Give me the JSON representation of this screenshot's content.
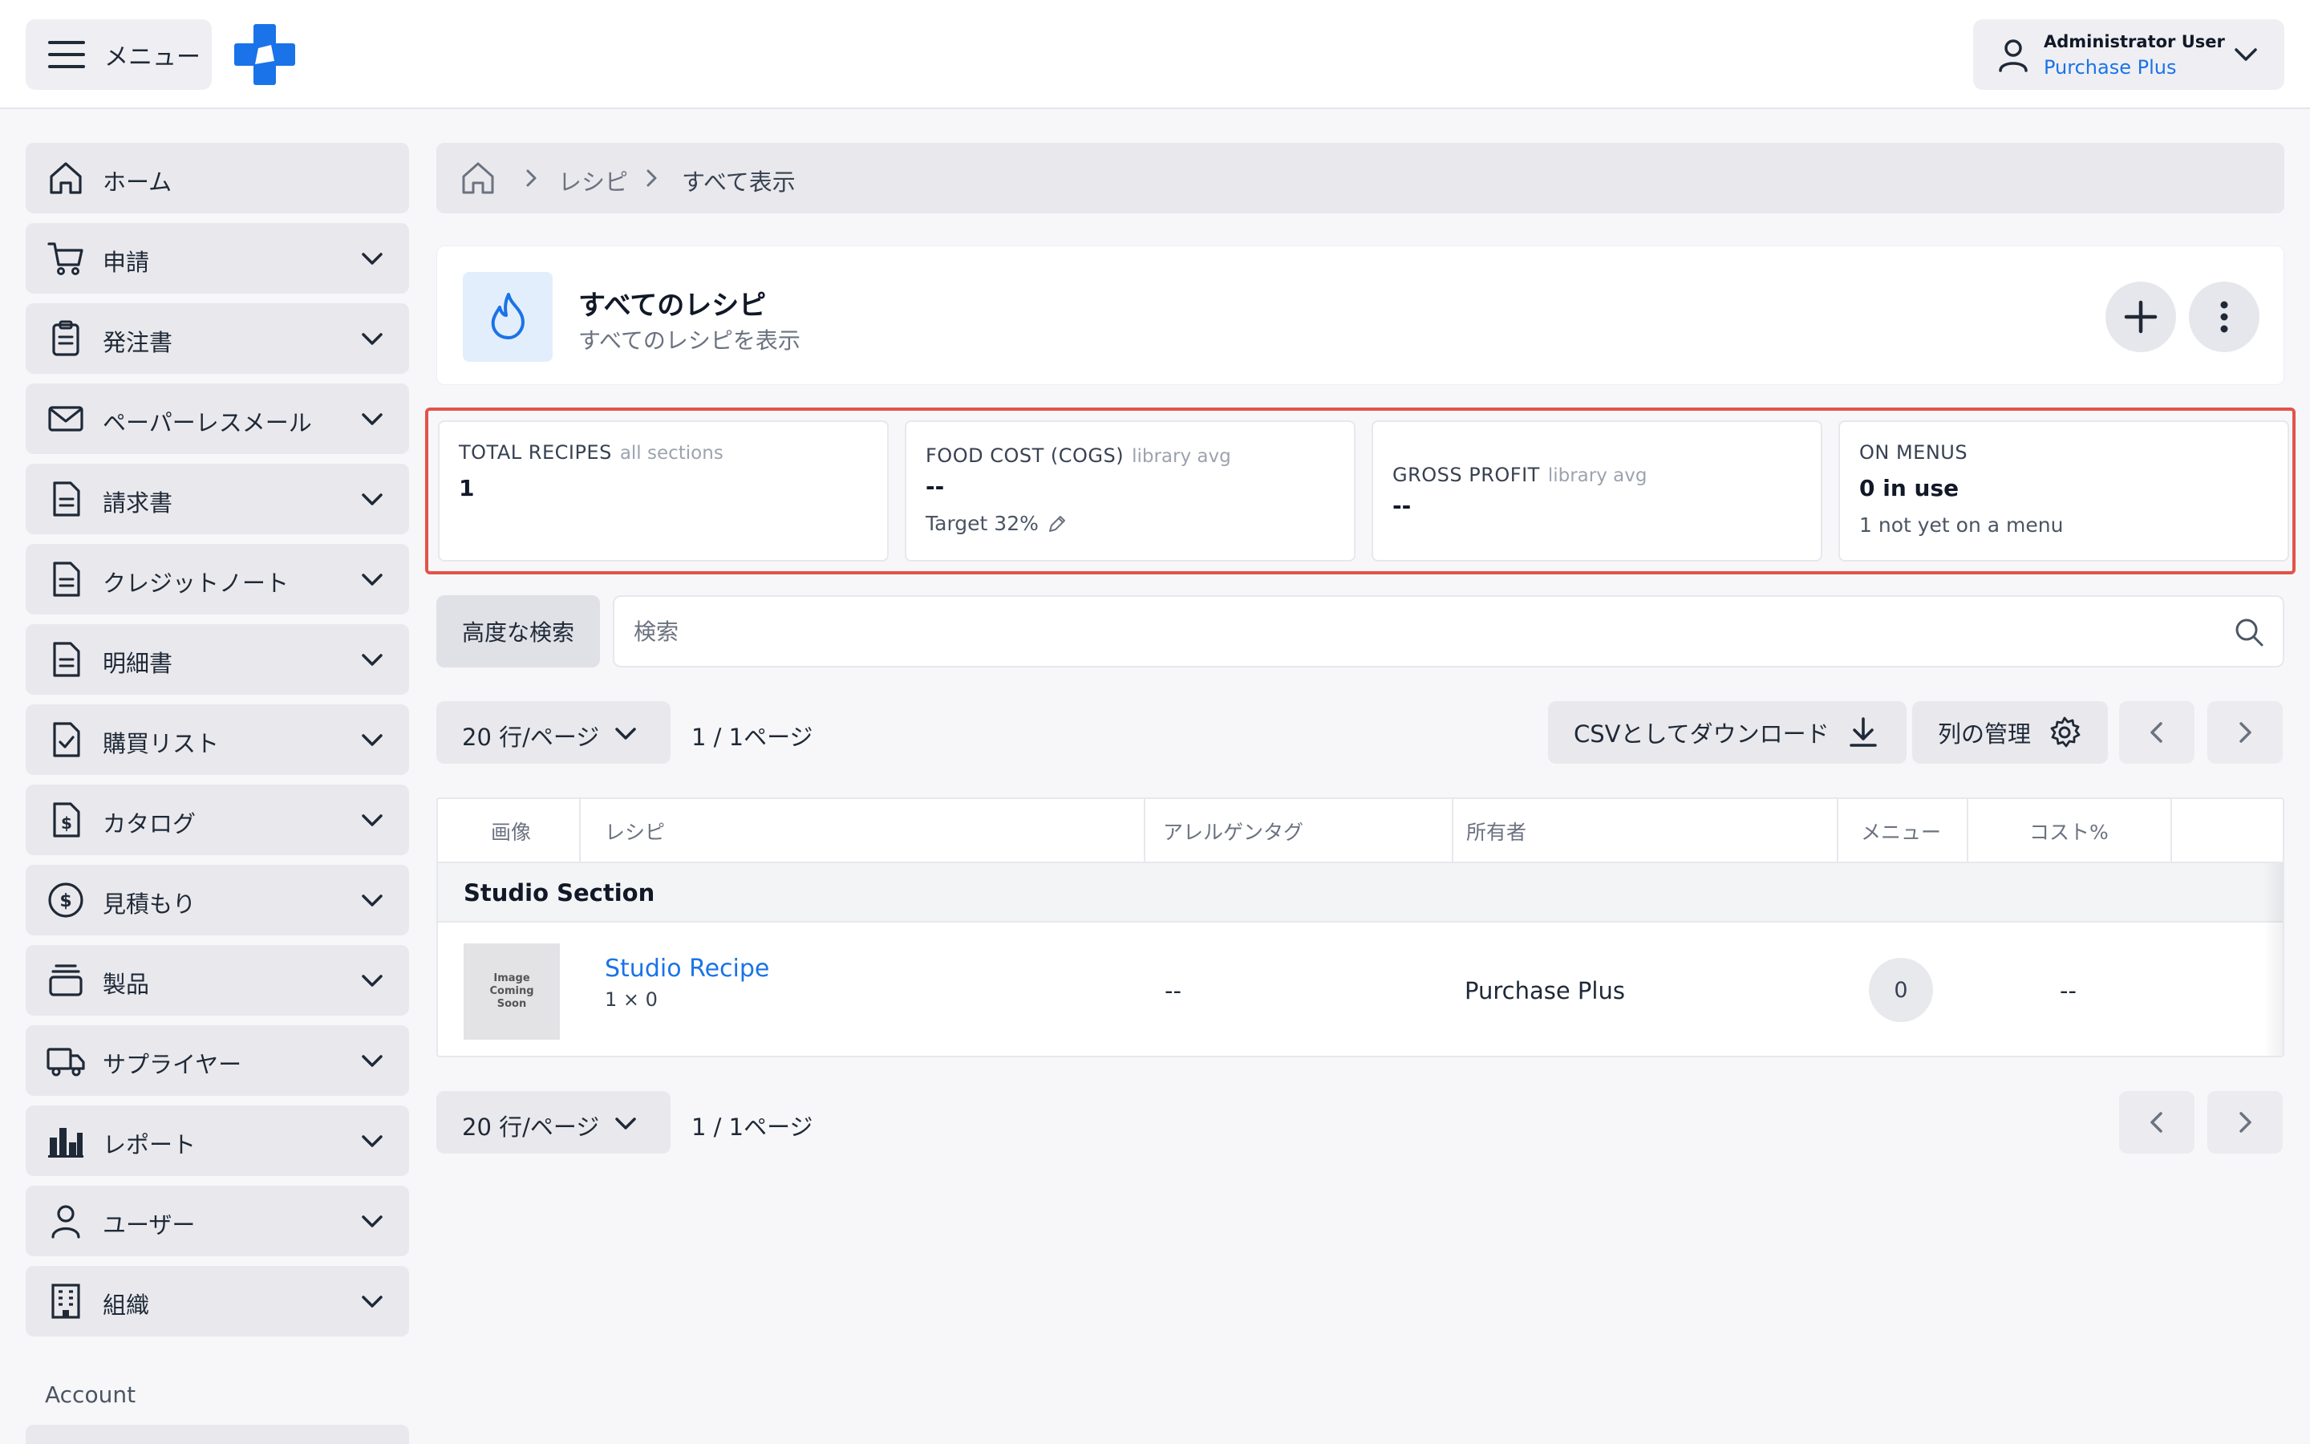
{
  "topbar": {
    "menu_label": "メニュー",
    "user_name": "Administrator User",
    "user_org": "Purchase Plus"
  },
  "sidebar": {
    "items": [
      {
        "label": "ホーム",
        "icon": "home-icon"
      },
      {
        "label": "申請",
        "icon": "cart-icon"
      },
      {
        "label": "発注書",
        "icon": "clipboard-icon"
      },
      {
        "label": "ペーパーレスメール",
        "icon": "mail-icon"
      },
      {
        "label": "請求書",
        "icon": "document-icon"
      },
      {
        "label": "クレジットノート",
        "icon": "document-icon"
      },
      {
        "label": "明細書",
        "icon": "document-icon"
      },
      {
        "label": "購買リスト",
        "icon": "checklist-icon"
      },
      {
        "label": "カタログ",
        "icon": "dollar-file-icon"
      },
      {
        "label": "見積もり",
        "icon": "dollar-circle-icon"
      },
      {
        "label": "製品",
        "icon": "stack-icon"
      },
      {
        "label": "サプライヤー",
        "icon": "truck-icon"
      },
      {
        "label": "レポート",
        "icon": "bar-chart-icon"
      },
      {
        "label": "ユーザー",
        "icon": "user-icon"
      },
      {
        "label": "組織",
        "icon": "building-icon"
      }
    ],
    "account_label": "Account"
  },
  "breadcrumb": {
    "items": [
      "レシピ",
      "すべて表示"
    ]
  },
  "header": {
    "title": "すべてのレシピ",
    "subtitle": "すべてのレシピを表示"
  },
  "stats": [
    {
      "title": "TOTAL RECIPES",
      "sub": "all sections",
      "value": "1",
      "extra": ""
    },
    {
      "title": "FOOD COST (COGS)",
      "sub": "library avg",
      "value": "--",
      "extra": "Target 32%"
    },
    {
      "title": "GROSS PROFIT",
      "sub": "library avg",
      "value": "--",
      "extra": ""
    },
    {
      "title": "ON MENUS",
      "sub": "",
      "value": "0 in use",
      "extra": "1 not yet on a menu"
    }
  ],
  "search": {
    "advanced_label": "高度な検索",
    "placeholder": "検索"
  },
  "pager": {
    "rows_label": "20 行/ページ",
    "page_info": "1 / 1ページ",
    "csv_label": "CSVとしてダウンロード",
    "columns_label": "列の管理"
  },
  "table": {
    "headers": [
      "画像",
      "レシピ",
      "アレルゲンタグ",
      "所有者",
      "メニュー",
      "コスト%"
    ],
    "section_name": "Studio Section",
    "rows": [
      {
        "image_text": "Image Coming Soon",
        "name": "Studio Recipe",
        "yield": "1 × 0",
        "allergens": "--",
        "owner": "Purchase Plus",
        "menus": "0",
        "cost_pct": "--"
      }
    ]
  },
  "colors": {
    "accent": "#1a73e8",
    "highlight_border": "#e2534a",
    "sidebar_bg": "#e9e9ed"
  }
}
